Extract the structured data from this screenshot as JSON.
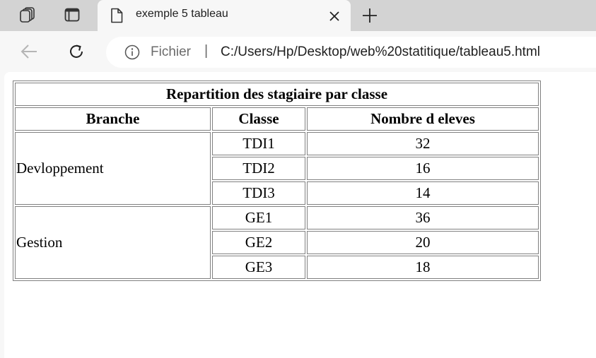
{
  "browser": {
    "tab": {
      "title": "exemple 5 tableau"
    },
    "address_bar": {
      "scheme_label": "Fichier",
      "separator": "|",
      "url": "C:/Users/Hp/Desktop/web%20statitique/tableau5.html"
    },
    "icons": {
      "workspaces": "workspaces-icon",
      "tab_actions": "tab-actions-icon",
      "page": "page-icon",
      "close": "close-icon",
      "new_tab": "plus-icon",
      "back": "back-arrow-icon",
      "refresh": "refresh-icon",
      "info": "info-icon"
    }
  },
  "table": {
    "caption": "Repartition des stagiaire par classe",
    "headers": [
      "Branche",
      "Classe",
      "Nombre d eleves"
    ],
    "groups": [
      {
        "branche": "Devloppement",
        "rows": [
          {
            "classe": "TDI1",
            "nombre": "32"
          },
          {
            "classe": "TDI2",
            "nombre": "16"
          },
          {
            "classe": "TDI3",
            "nombre": "14"
          }
        ]
      },
      {
        "branche": "Gestion",
        "rows": [
          {
            "classe": "GE1",
            "nombre": "36"
          },
          {
            "classe": "GE2",
            "nombre": "20"
          },
          {
            "classe": "GE3",
            "nombre": "18"
          }
        ]
      }
    ]
  }
}
